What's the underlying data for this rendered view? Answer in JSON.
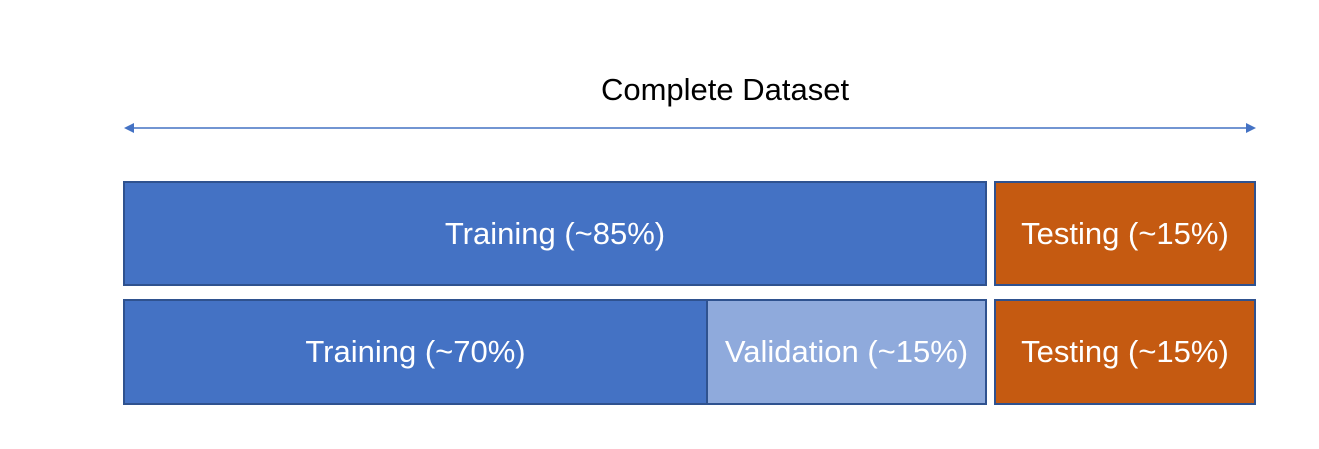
{
  "title": "Complete Dataset",
  "colors": {
    "training": "#4472c4",
    "validation": "#8faadc",
    "testing": "#c55a11",
    "border": "#2f528f",
    "arrow": "#4472c4"
  },
  "split_1": {
    "training_label": "Training (~85%)",
    "testing_label": "Testing (~15%)"
  },
  "split_2": {
    "training_label": "Training (~70%)",
    "validation_label": "Validation (~15%)",
    "testing_label": "Testing (~15%)"
  }
}
